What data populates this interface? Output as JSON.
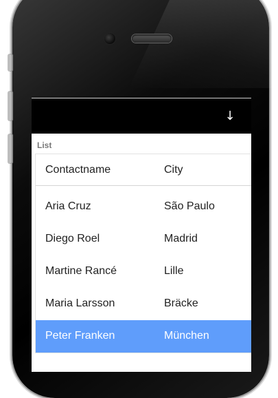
{
  "screen": {
    "topbar": {
      "action_icon": "down-arrow-icon",
      "action_glyph": "↓"
    },
    "list": {
      "label": "List",
      "columns": [
        "Contactname",
        "City"
      ],
      "rows": [
        {
          "name": "Aria Cruz",
          "city": "São Paulo",
          "selected": false
        },
        {
          "name": "Diego Roel",
          "city": "Madrid",
          "selected": false
        },
        {
          "name": "Martine Rancé",
          "city": "Lille",
          "selected": false
        },
        {
          "name": "Maria Larsson",
          "city": "Bräcke",
          "selected": false
        },
        {
          "name": "Peter Franken",
          "city": "München",
          "selected": true
        }
      ],
      "selected_color": "#5f9dfb"
    }
  }
}
